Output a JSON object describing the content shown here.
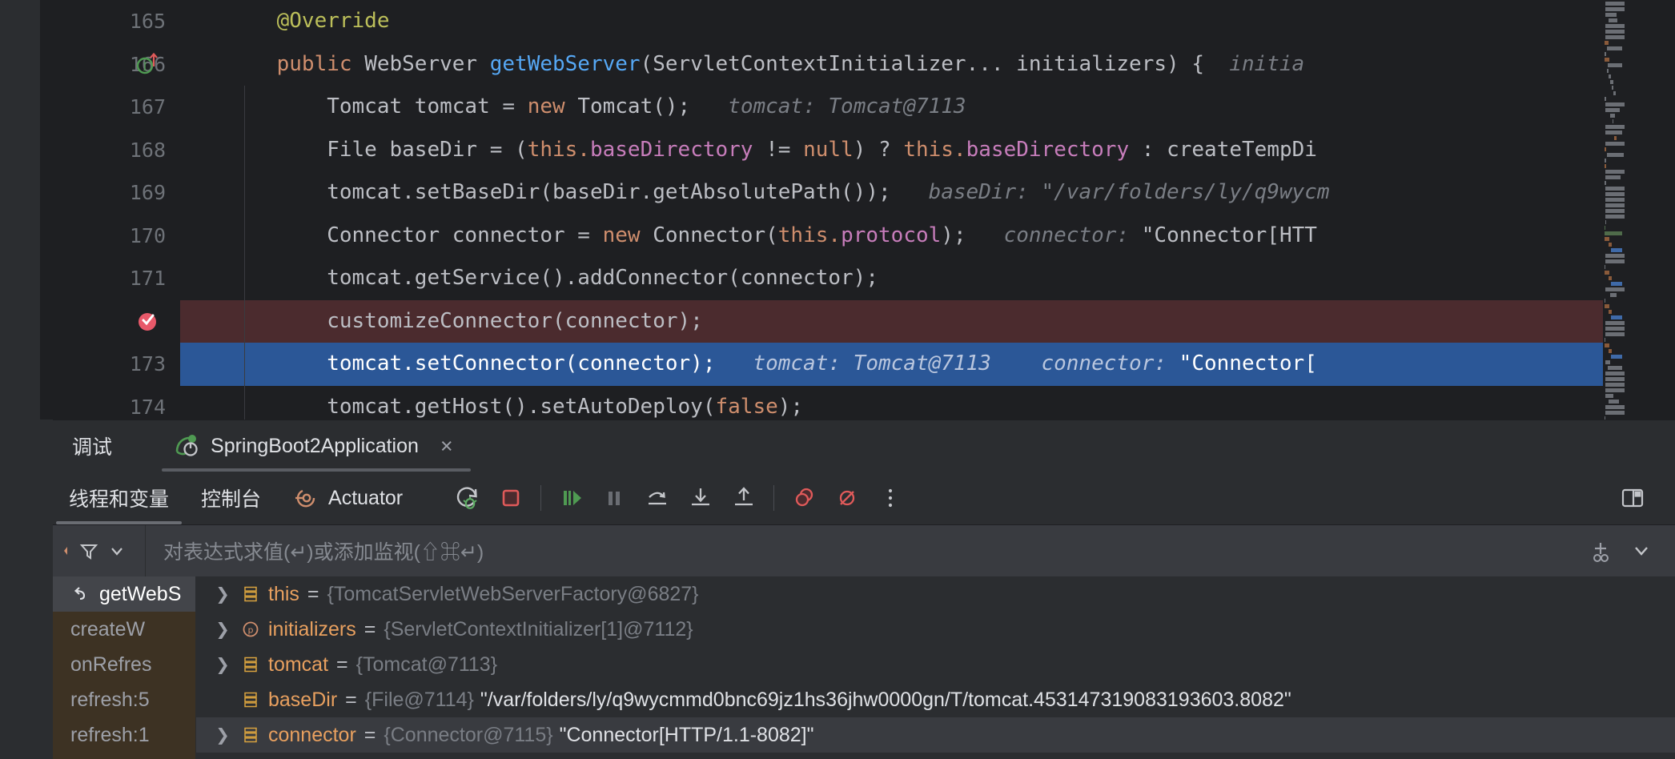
{
  "editor": {
    "lines": [
      {
        "number": "165",
        "gutter_icon": "",
        "highlight": "none",
        "indent": 0,
        "tokens": [
          {
            "cls": "t-anno",
            "text": "    @Override"
          }
        ]
      },
      {
        "number": "166",
        "gutter_icon": "run-method-icon",
        "highlight": "none",
        "indent": 0,
        "tokens": [
          {
            "cls": "t-kw",
            "text": "    public "
          },
          {
            "cls": "t-txt",
            "text": "WebServer "
          },
          {
            "cls": "t-mtd",
            "text": "getWebServer"
          },
          {
            "cls": "t-txt",
            "text": "(ServletContextInitializer... initializers) { "
          },
          {
            "cls": "t-hint",
            "text": " initia"
          }
        ]
      },
      {
        "number": "167",
        "gutter_icon": "",
        "highlight": "none",
        "indent": 1,
        "tokens": [
          {
            "cls": "t-txt",
            "text": "        Tomcat tomcat = "
          },
          {
            "cls": "t-kw",
            "text": "new "
          },
          {
            "cls": "t-txt",
            "text": "Tomcat();"
          },
          {
            "cls": "t-hint",
            "text": "   tomcat: Tomcat@7113"
          }
        ]
      },
      {
        "number": "168",
        "gutter_icon": "",
        "highlight": "none",
        "indent": 1,
        "tokens": [
          {
            "cls": "t-txt",
            "text": "        File baseDir = ("
          },
          {
            "cls": "t-kw",
            "text": "this."
          },
          {
            "cls": "t-fld",
            "text": "baseDirectory "
          },
          {
            "cls": "t-txt",
            "text": "!= "
          },
          {
            "cls": "t-kw",
            "text": "null"
          },
          {
            "cls": "t-txt",
            "text": ") ? "
          },
          {
            "cls": "t-kw",
            "text": "this."
          },
          {
            "cls": "t-fld",
            "text": "baseDirectory "
          },
          {
            "cls": "t-txt",
            "text": ": createTempDi"
          }
        ]
      },
      {
        "number": "169",
        "gutter_icon": "",
        "highlight": "none",
        "indent": 1,
        "tokens": [
          {
            "cls": "t-txt",
            "text": "        tomcat.setBaseDir(baseDir.getAbsolutePath());"
          },
          {
            "cls": "t-hint",
            "text": "   baseDir: \"/var/folders/ly/q9wycm"
          }
        ]
      },
      {
        "number": "170",
        "gutter_icon": "",
        "highlight": "none",
        "indent": 1,
        "tokens": [
          {
            "cls": "t-txt",
            "text": "        Connector connector = "
          },
          {
            "cls": "t-kw",
            "text": "new "
          },
          {
            "cls": "t-txt",
            "text": "Connector("
          },
          {
            "cls": "t-kw",
            "text": "this."
          },
          {
            "cls": "t-fld",
            "text": "protocol"
          },
          {
            "cls": "t-txt",
            "text": ");"
          },
          {
            "cls": "t-hint",
            "text": "   connector: "
          },
          {
            "cls": "t-txt",
            "text": "\"Connector[HTT"
          }
        ]
      },
      {
        "number": "171",
        "gutter_icon": "",
        "highlight": "none",
        "indent": 1,
        "tokens": [
          {
            "cls": "t-txt",
            "text": "        tomcat.getService().addConnector(connector);"
          }
        ]
      },
      {
        "number": "",
        "gutter_icon": "breakpoint-icon",
        "highlight": "red",
        "indent": 1,
        "tokens": [
          {
            "cls": "t-txt",
            "text": "        customizeConnector(connector);"
          }
        ]
      },
      {
        "number": "173",
        "gutter_icon": "",
        "highlight": "blue",
        "indent": 1,
        "tokens": [
          {
            "cls": "t-txt",
            "text": "        tomcat.setConnector(connector);"
          },
          {
            "cls": "t-hint",
            "text": "   tomcat: Tomcat@7113"
          },
          {
            "cls": "t-hint",
            "text": "    connector: "
          },
          {
            "cls": "t-txt",
            "text": "\"Connector["
          }
        ]
      },
      {
        "number": "174",
        "gutter_icon": "",
        "highlight": "none",
        "indent": 1,
        "tokens": [
          {
            "cls": "t-txt",
            "text": "        tomcat.getHost().setAutoDeploy("
          },
          {
            "cls": "t-kw",
            "text": "false"
          },
          {
            "cls": "t-txt",
            "text": ");"
          }
        ]
      }
    ]
  },
  "debug": {
    "panel_title": "调试",
    "run_tab": {
      "label": "SpringBoot2Application",
      "icon": "spring-boot-run-icon",
      "close_label": "×"
    },
    "tabs": [
      {
        "label": "线程和变量",
        "icon": "",
        "active": true
      },
      {
        "label": "控制台",
        "icon": "",
        "active": false
      },
      {
        "label": "Actuator",
        "icon": "actuator-icon",
        "active": false
      }
    ],
    "toolbar_buttons": [
      {
        "name": "rerun-debug-button",
        "icon": "rerun-debug-icon"
      },
      {
        "name": "stop-button",
        "icon": "stop-icon"
      },
      {
        "name": "separator-1",
        "icon": "separator"
      },
      {
        "name": "resume-program-button",
        "icon": "resume-icon"
      },
      {
        "name": "pause-program-button",
        "icon": "pause-icon"
      },
      {
        "name": "step-over-button",
        "icon": "step-over-icon"
      },
      {
        "name": "step-into-button",
        "icon": "step-into-icon"
      },
      {
        "name": "step-out-button",
        "icon": "step-out-icon"
      },
      {
        "name": "separator-2",
        "icon": "separator"
      },
      {
        "name": "view-breakpoints-button",
        "icon": "view-breakpoints-icon"
      },
      {
        "name": "mute-breakpoints-button",
        "icon": "mute-breakpoints-icon"
      },
      {
        "name": "more-options-button",
        "icon": "more-vertical-icon"
      }
    ],
    "layout_button": {
      "name": "layout-settings-button",
      "icon": "layout-icon"
    },
    "evaluate": {
      "placeholder": "对表达式求值(↵)或添加监视(⇧⌘↵)",
      "filter_icon": "filter-icon",
      "chevron_icon": "chevron-down-icon",
      "add-watch_icon": "add-watch-icon",
      "collapse_icon": "chevron-down-icon"
    },
    "frames": [
      {
        "label": "getWebS",
        "icon": "return-arrow-icon",
        "active": true
      },
      {
        "label": "createW",
        "icon": "",
        "active": false
      },
      {
        "label": "onRefres",
        "icon": "",
        "active": false
      },
      {
        "label": "refresh:5",
        "icon": "",
        "active": false
      },
      {
        "label": "refresh:1",
        "icon": "",
        "active": false
      }
    ],
    "variables": [
      {
        "expandable": true,
        "icon": "field-icon",
        "name": "this",
        "eq": "=",
        "type": "{TomcatServletWebServerFactory@6827}",
        "value": "",
        "selected": false
      },
      {
        "expandable": true,
        "icon": "parameter-icon",
        "name": "initializers",
        "eq": "=",
        "type": "{ServletContextInitializer[1]@7112}",
        "value": "",
        "selected": false
      },
      {
        "expandable": true,
        "icon": "field-icon",
        "name": "tomcat",
        "eq": "=",
        "type": "{Tomcat@7113}",
        "value": "",
        "selected": false
      },
      {
        "expandable": false,
        "icon": "field-icon",
        "name": "baseDir",
        "eq": "=",
        "type": "{File@7114}",
        "value": "\"/var/folders/ly/q9wycmmd0bnc69jz1hs36jhw0000gn/T/tomcat.45314731908319360‌3.8082\"",
        "selected": false
      },
      {
        "expandable": true,
        "icon": "field-icon",
        "name": "connector",
        "eq": "=",
        "type": "{Connector@7115}",
        "value": "\"Connector[HTTP/1.1-8082]\"",
        "selected": true
      }
    ]
  },
  "colors": {
    "editor_bg": "#1e1f22",
    "panel_bg": "#2b2d30",
    "selection_blue": "#2b5797",
    "breakpoint_red_line": "#4b2b2e",
    "breakpoint_red": "#e55765",
    "accent_orange": "#e8a05f",
    "keyword_orange": "#cf8e6d",
    "method_blue": "#56a8f5",
    "field_purple": "#c77dbb",
    "annotation_yellow": "#bcbf5a",
    "frames_bg": "#3d3223",
    "text_primary": "#bcbec4",
    "text_dim": "#7a7e85",
    "green_run": "#5fad65"
  }
}
